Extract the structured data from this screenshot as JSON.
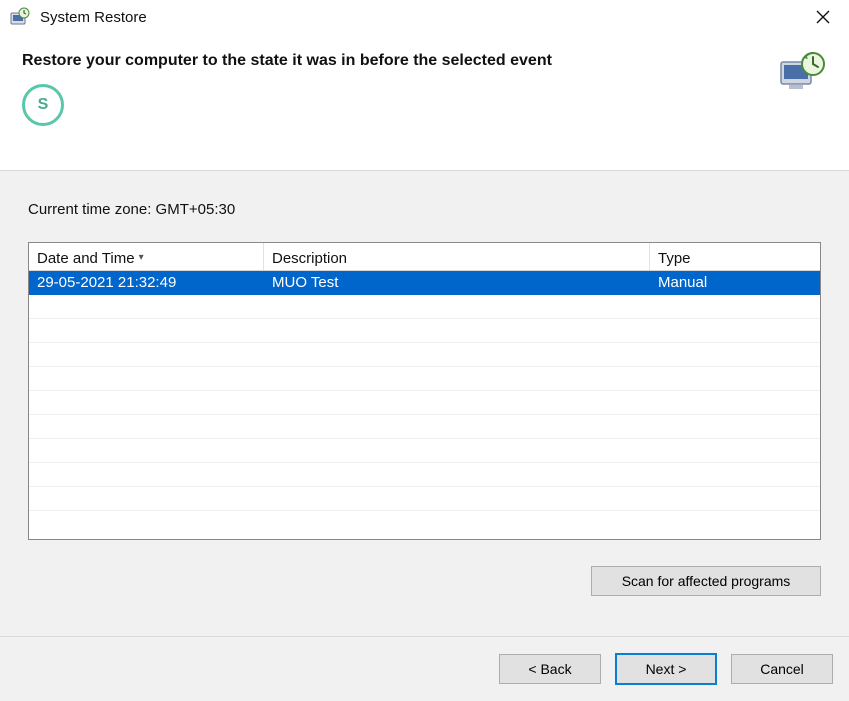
{
  "window": {
    "title": "System Restore"
  },
  "header": {
    "heading": "Restore your computer to the state it was in before the selected event",
    "watermark_text": "S"
  },
  "content": {
    "timezone_label": "Current time zone: GMT+05:30",
    "columns": {
      "datetime": "Date and Time",
      "description": "Description",
      "type": "Type"
    },
    "rows": [
      {
        "datetime": "29-05-2021 21:32:49",
        "description": "MUO Test",
        "type": "Manual",
        "selected": true
      }
    ],
    "scan_button": "Scan for affected programs"
  },
  "footer": {
    "back": "< Back",
    "next": "Next >",
    "cancel": "Cancel"
  }
}
